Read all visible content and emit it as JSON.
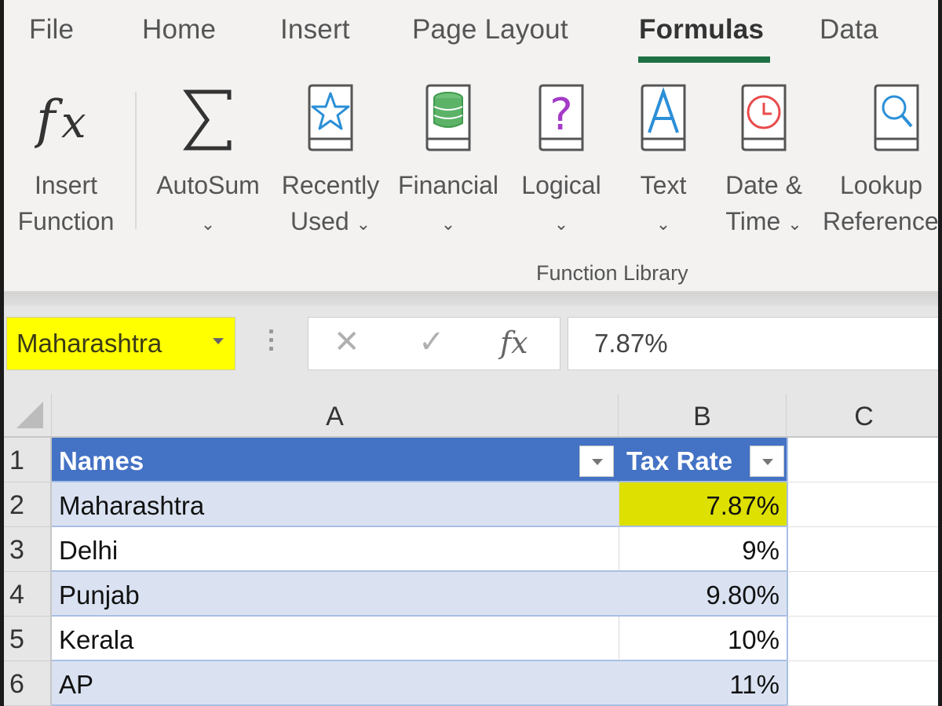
{
  "ribbon": {
    "tabs": [
      {
        "label": "File",
        "active": false
      },
      {
        "label": "Home",
        "active": false
      },
      {
        "label": "Insert",
        "active": false
      },
      {
        "label": "Page Layout",
        "active": false
      },
      {
        "label": "Formulas",
        "active": true
      },
      {
        "label": "Data",
        "active": false
      }
    ],
    "accent_color": "#1e7145",
    "buttons": [
      {
        "line1": "Insert",
        "line2": "Function",
        "icon": "fx-icon",
        "has_dropdown": false
      },
      {
        "line1": "AutoSum",
        "line2": "",
        "icon": "sigma-icon",
        "has_dropdown": true
      },
      {
        "line1": "Recently",
        "line2": "Used",
        "icon": "star-book-icon",
        "has_dropdown": true
      },
      {
        "line1": "Financial",
        "line2": "",
        "icon": "coins-book-icon",
        "has_dropdown": true
      },
      {
        "line1": "Logical",
        "line2": "",
        "icon": "question-book-icon",
        "has_dropdown": true
      },
      {
        "line1": "Text",
        "line2": "",
        "icon": "letter-a-book-icon",
        "has_dropdown": true
      },
      {
        "line1": "Date &",
        "line2": "Time",
        "icon": "clock-book-icon",
        "has_dropdown": true
      },
      {
        "line1": "Lookup",
        "line2": "Reference",
        "icon": "magnifier-book-icon",
        "has_dropdown": false
      }
    ],
    "group_label": "Function Library",
    "chevron": "⌄"
  },
  "formula_bar": {
    "name_box": "Maharashtra",
    "name_box_color": "#ffff00",
    "cancel_icon": "✕",
    "enter_icon": "✓",
    "fx_label": "fx",
    "value": "7.87%"
  },
  "sheet": {
    "columns": [
      "A",
      "B",
      "C"
    ],
    "rows": [
      "1",
      "2",
      "3",
      "4",
      "5",
      "6"
    ],
    "table_header": {
      "names": "Names",
      "tax_rate": "Tax Rate"
    },
    "header_color": "#4472c4",
    "band_color": "#dae2f2",
    "data": [
      {
        "name": "Maharashtra",
        "rate": "7.87%",
        "highlighted": true
      },
      {
        "name": "Delhi",
        "rate": "9%",
        "highlighted": false
      },
      {
        "name": "Punjab",
        "rate": "9.80%",
        "highlighted": false
      },
      {
        "name": "Kerala",
        "rate": "10%",
        "highlighted": false
      },
      {
        "name": "AP",
        "rate": "11%",
        "highlighted": false
      }
    ],
    "highlight_color": "#dde000"
  }
}
